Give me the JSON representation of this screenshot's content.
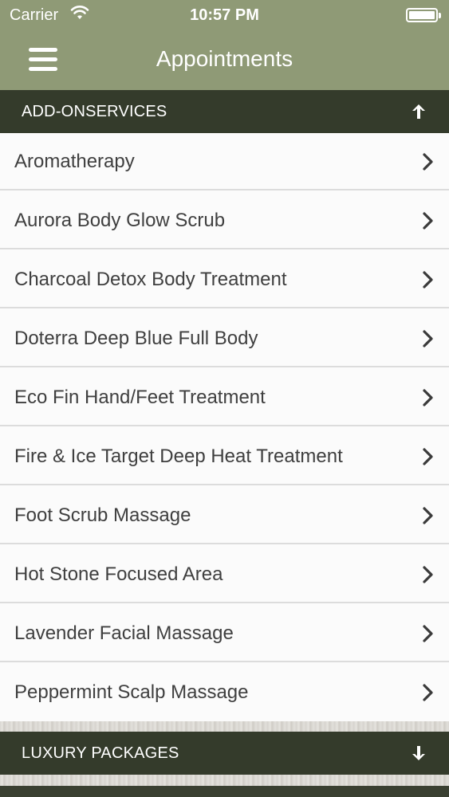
{
  "status_bar": {
    "carrier": "Carrier",
    "time": "10:57 PM",
    "wifi_icon": "wifi-icon",
    "battery_icon": "battery-icon"
  },
  "header": {
    "title": "Appointments",
    "menu_icon": "hamburger-menu-icon",
    "color": "#8f9a76"
  },
  "sections": [
    {
      "label": "ADD-ONSERVICES",
      "expanded": true,
      "toggle_icon": "arrow-up-icon",
      "items": [
        "Aromatherapy",
        "Aurora Body Glow Scrub",
        "Charcoal Detox Body Treatment",
        "Doterra Deep Blue Full Body",
        "Eco Fin Hand/Feet Treatment",
        "Fire & Ice Target Deep Heat Treatment",
        "Foot Scrub Massage",
        "Hot Stone Focused Area",
        "Lavender Facial Massage",
        "Peppermint Scalp Massage"
      ]
    },
    {
      "label": "LUXURY PACKAGES",
      "expanded": false,
      "toggle_icon": "arrow-down-icon",
      "items": []
    }
  ],
  "colors": {
    "section_header": "#343b2b",
    "list_background": "#fbfbfb",
    "item_text": "#3f3f3f"
  }
}
